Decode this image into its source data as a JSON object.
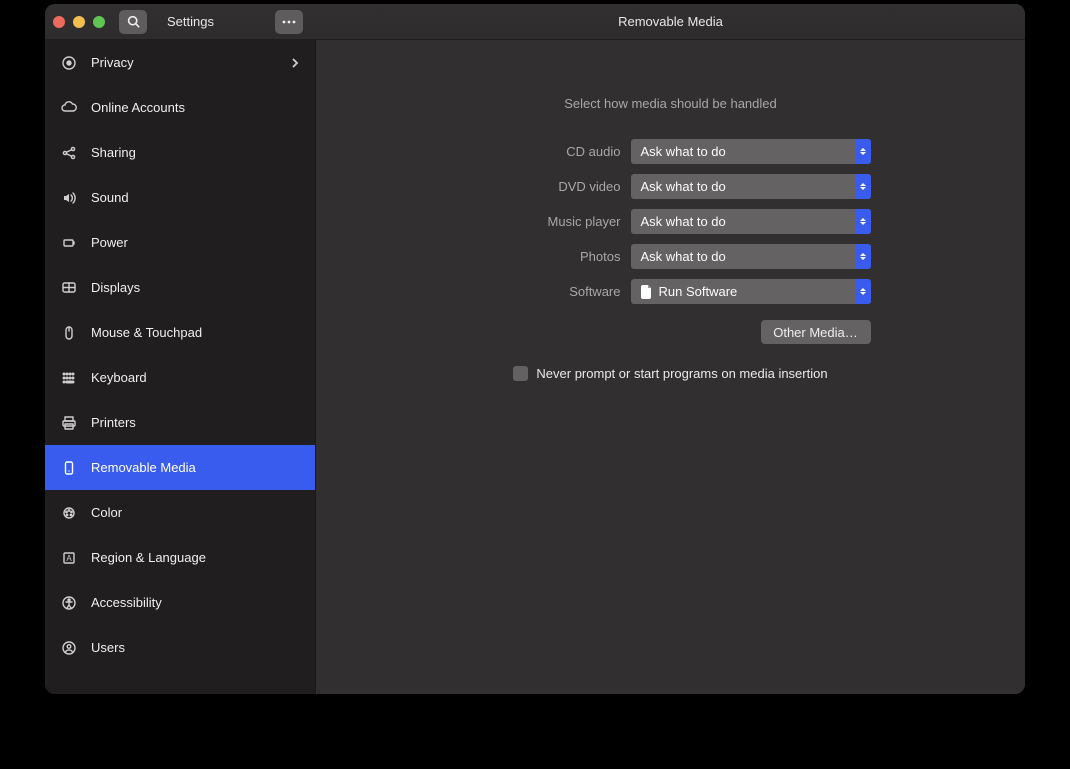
{
  "header": {
    "settings_label": "Settings",
    "title": "Removable Media"
  },
  "sidebar": {
    "items": [
      {
        "label": "Privacy",
        "icon": "privacy-icon",
        "has_chevron": true
      },
      {
        "label": "Online Accounts",
        "icon": "cloud-icon"
      },
      {
        "label": "Sharing",
        "icon": "share-icon"
      },
      {
        "label": "Sound",
        "icon": "sound-icon"
      },
      {
        "label": "Power",
        "icon": "power-icon"
      },
      {
        "label": "Displays",
        "icon": "displays-icon"
      },
      {
        "label": "Mouse & Touchpad",
        "icon": "mouse-icon"
      },
      {
        "label": "Keyboard",
        "icon": "keyboard-icon"
      },
      {
        "label": "Printers",
        "icon": "printers-icon"
      },
      {
        "label": "Removable Media",
        "icon": "removable-media-icon",
        "selected": true
      },
      {
        "label": "Color",
        "icon": "color-icon"
      },
      {
        "label": "Region & Language",
        "icon": "region-icon"
      },
      {
        "label": "Accessibility",
        "icon": "accessibility-icon"
      },
      {
        "label": "Users",
        "icon": "users-icon"
      }
    ]
  },
  "main": {
    "intro": "Select how media should be handled",
    "rows": [
      {
        "label": "CD audio",
        "value": "Ask what to do"
      },
      {
        "label": "DVD video",
        "value": "Ask what to do"
      },
      {
        "label": "Music player",
        "value": "Ask what to do"
      },
      {
        "label": "Photos",
        "value": "Ask what to do"
      },
      {
        "label": "Software",
        "value": "Run Software",
        "has_icon": true
      }
    ],
    "other_media_label": "Other Media…",
    "checkbox_label": "Never prompt or start programs on media insertion"
  }
}
